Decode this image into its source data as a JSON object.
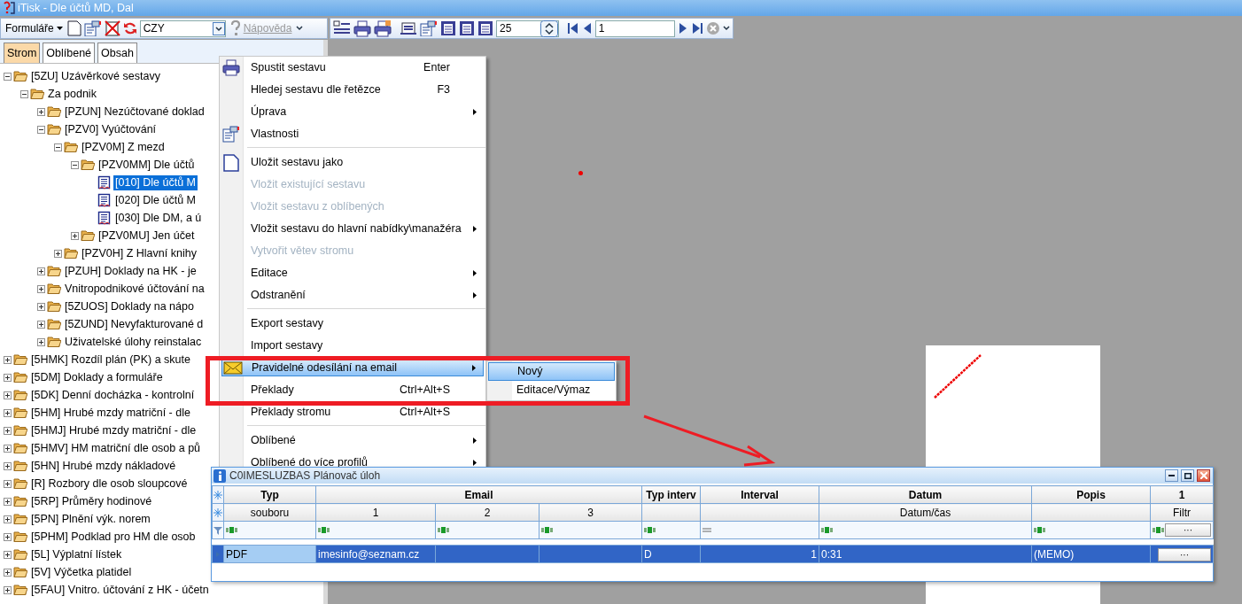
{
  "window": {
    "title": "iTisk - Dle účtů MD, Dal"
  },
  "toolbar": {
    "forms_menu": "Formuláře",
    "language": "CZY",
    "help": {
      "label": "Nápověda",
      "disabled": true
    },
    "page_size": "25",
    "page": "1"
  },
  "tabs": [
    {
      "label": "Strom",
      "selected": true
    },
    {
      "label": "Oblíbené",
      "selected": false
    },
    {
      "label": "Obsah",
      "selected": false
    }
  ],
  "tree": [
    {
      "label": "[5ZU]  Uzávěrkové sestavy",
      "kind": "folder",
      "expanded": true,
      "selected": false,
      "children": [
        {
          "label": "Za podnik",
          "kind": "folder",
          "expanded": true,
          "selected": false,
          "children": [
            {
              "label": "[PZUN] Nezúčtované doklad",
              "kind": "folder",
              "expanded": false,
              "selected": false
            },
            {
              "label": "[PZV0] Vyúčtování",
              "kind": "folder",
              "expanded": true,
              "selected": false,
              "children": [
                {
                  "label": "[PZV0M]  Z mezd",
                  "kind": "folder",
                  "expanded": true,
                  "selected": false,
                  "children": [
                    {
                      "label": "[PZV0MM]  Dle účtů",
                      "kind": "folder",
                      "expanded": true,
                      "selected": false,
                      "children": [
                        {
                          "label": "[010] Dle účtů M",
                          "kind": "report",
                          "selected": true
                        },
                        {
                          "label": "[020] Dle účtů M",
                          "kind": "report",
                          "selected": false
                        },
                        {
                          "label": "[030] Dle DM, a ú",
                          "kind": "report",
                          "selected": false
                        }
                      ]
                    },
                    {
                      "label": "[PZV0MU]  Jen účet",
                      "kind": "folder",
                      "expanded": false,
                      "selected": false
                    }
                  ]
                },
                {
                  "label": "[PZV0H]  Z Hlavní knihy",
                  "kind": "folder",
                  "expanded": false,
                  "selected": false
                }
              ]
            },
            {
              "label": "[PZUH] Doklady na HK - je",
              "kind": "folder",
              "expanded": false,
              "selected": false
            },
            {
              "label": "Vnitropodnikové účtování na",
              "kind": "folder",
              "expanded": false,
              "selected": false
            },
            {
              "label": "[5ZUOS]  Doklady na nápo",
              "kind": "folder",
              "expanded": false,
              "selected": false
            },
            {
              "label": "[5ZUND]  Nevyfakturované d",
              "kind": "folder",
              "expanded": false,
              "selected": false
            },
            {
              "label": "Uživatelské úlohy reinstalac",
              "kind": "folder",
              "expanded": false,
              "selected": false
            }
          ]
        }
      ]
    },
    {
      "label": "[5HMK]  Rozdíl plán (PK) a skute",
      "kind": "folder",
      "expanded": false,
      "selected": false
    },
    {
      "label": "[5DM]  Doklady a formuláře",
      "kind": "folder",
      "expanded": false,
      "selected": false
    },
    {
      "label": "[5DK]  Denní docházka - kontrolní",
      "kind": "folder",
      "expanded": false,
      "selected": false
    },
    {
      "label": "[5HM]  Hrubé mzdy matriční - dle",
      "kind": "folder",
      "expanded": false,
      "selected": false
    },
    {
      "label": "[5HMJ]  Hrubé mzdy matriční - dle",
      "kind": "folder",
      "expanded": false,
      "selected": false
    },
    {
      "label": "[5HMV] HM matriční dle osob a pů",
      "kind": "folder",
      "expanded": false,
      "selected": false
    },
    {
      "label": "[5HN]  Hrubé mzdy nákladové",
      "kind": "folder",
      "expanded": false,
      "selected": false
    },
    {
      "label": "[R]  Rozbory dle osob sloupcové",
      "kind": "folder",
      "expanded": false,
      "selected": false
    },
    {
      "label": "[5RP]  Průměry hodinové",
      "kind": "folder",
      "expanded": false,
      "selected": false
    },
    {
      "label": "[5PN]  Plnění výk. norem",
      "kind": "folder",
      "expanded": false,
      "selected": false
    },
    {
      "label": "[5PHM]  Podklad pro HM dle osob",
      "kind": "folder",
      "expanded": false,
      "selected": false
    },
    {
      "label": "[5L] Výplatní lístek",
      "kind": "folder",
      "expanded": false,
      "selected": false
    },
    {
      "label": "[5V]  Výčetka platidel",
      "kind": "folder",
      "expanded": false,
      "selected": false
    },
    {
      "label": "[5FAU]  Vnitro. účtování z HK - účetn",
      "kind": "folder",
      "expanded": false,
      "selected": false
    }
  ],
  "context_menu": [
    {
      "kind": "item",
      "label": "Spustit sestavu",
      "shortcut": "Enter",
      "has_submenu": false,
      "disabled": false,
      "selected": false
    },
    {
      "kind": "item",
      "label": "Hledej sestavu dle řetězce",
      "shortcut": "F3",
      "has_submenu": false,
      "disabled": false,
      "selected": false
    },
    {
      "kind": "item",
      "label": "Úprava",
      "has_submenu": true,
      "disabled": false,
      "selected": false
    },
    {
      "kind": "item",
      "label": "Vlastnosti",
      "has_submenu": false,
      "disabled": false,
      "selected": false
    },
    {
      "kind": "separator"
    },
    {
      "kind": "item",
      "label": "Uložit sestavu jako",
      "has_submenu": false,
      "disabled": false,
      "selected": false
    },
    {
      "kind": "item",
      "label": "Vložit existující sestavu",
      "has_submenu": false,
      "disabled": true,
      "selected": false
    },
    {
      "kind": "item",
      "label": "Vložit sestavu z oblíbených",
      "has_submenu": false,
      "disabled": true,
      "selected": false
    },
    {
      "kind": "item",
      "label": "Vložit sestavu do hlavní nabídky\\manažéra",
      "has_submenu": true,
      "disabled": false,
      "selected": false
    },
    {
      "kind": "item",
      "label": "Vytvořit větev stromu",
      "has_submenu": false,
      "disabled": true,
      "selected": false
    },
    {
      "kind": "item",
      "label": "Editace",
      "has_submenu": true,
      "disabled": false,
      "selected": false
    },
    {
      "kind": "item",
      "label": "Odstranění",
      "has_submenu": true,
      "disabled": false,
      "selected": false
    },
    {
      "kind": "separator"
    },
    {
      "kind": "item",
      "label": "Export sestavy",
      "has_submenu": false,
      "disabled": false,
      "selected": false
    },
    {
      "kind": "item",
      "label": "Import sestavy",
      "has_submenu": false,
      "disabled": false,
      "selected": false
    },
    {
      "kind": "item",
      "label": "Pravidelné odesílání na email",
      "has_submenu": true,
      "disabled": false,
      "selected": true
    },
    {
      "kind": "item",
      "label": "Překlady",
      "shortcut": "Ctrl+Alt+S",
      "has_submenu": false,
      "disabled": false,
      "selected": false
    },
    {
      "kind": "item",
      "label": "Překlady stromu",
      "shortcut": "Ctrl+Alt+S",
      "has_submenu": false,
      "disabled": false,
      "selected": false
    },
    {
      "kind": "separator"
    },
    {
      "kind": "item",
      "label": "Oblíbené",
      "has_submenu": true,
      "disabled": false,
      "selected": false
    },
    {
      "kind": "item",
      "label": "Oblíbené do více profilů",
      "has_submenu": true,
      "disabled": false,
      "selected": false
    }
  ],
  "submenu": [
    {
      "label": "Nový",
      "selected": true
    },
    {
      "label": "Editace/Výmaz",
      "selected": false
    }
  ],
  "dialog": {
    "title": "C0IMESLUZBAS Plánovač úloh",
    "header_groups": [
      {
        "label": "Typ",
        "sub": [
          "souboru"
        ]
      },
      {
        "label": "Email",
        "sub": [
          "1",
          "2",
          "3"
        ]
      },
      {
        "label": "Typ interv"
      },
      {
        "label": "Interval"
      },
      {
        "label": "Datum",
        "sub": [
          "Datum/čas"
        ]
      },
      {
        "label": "Popis"
      },
      {
        "label": "1",
        "sub": [
          "Filtr"
        ]
      }
    ],
    "filters": [
      {
        "kind": "text"
      },
      {
        "kind": "text"
      },
      {
        "kind": "text"
      },
      {
        "kind": "text"
      },
      {
        "kind": "text"
      },
      {
        "kind": "equals"
      },
      {
        "kind": "text"
      },
      {
        "kind": "text"
      },
      {
        "kind": "text",
        "button": "···"
      }
    ],
    "rows": [
      {
        "selected": true,
        "file_type": {
          "text": "PDF",
          "focused": true
        },
        "email_1": {
          "text": "imesinfo@seznam.cz",
          "focused": false
        },
        "interval_type": {
          "text": "D",
          "focused": false
        },
        "interval": {
          "text": "1",
          "focused": false
        },
        "datetime": {
          "text": "0:31",
          "focused": false
        },
        "description": {
          "text": "(MEMO)",
          "focused": false
        },
        "button": "···"
      }
    ]
  }
}
